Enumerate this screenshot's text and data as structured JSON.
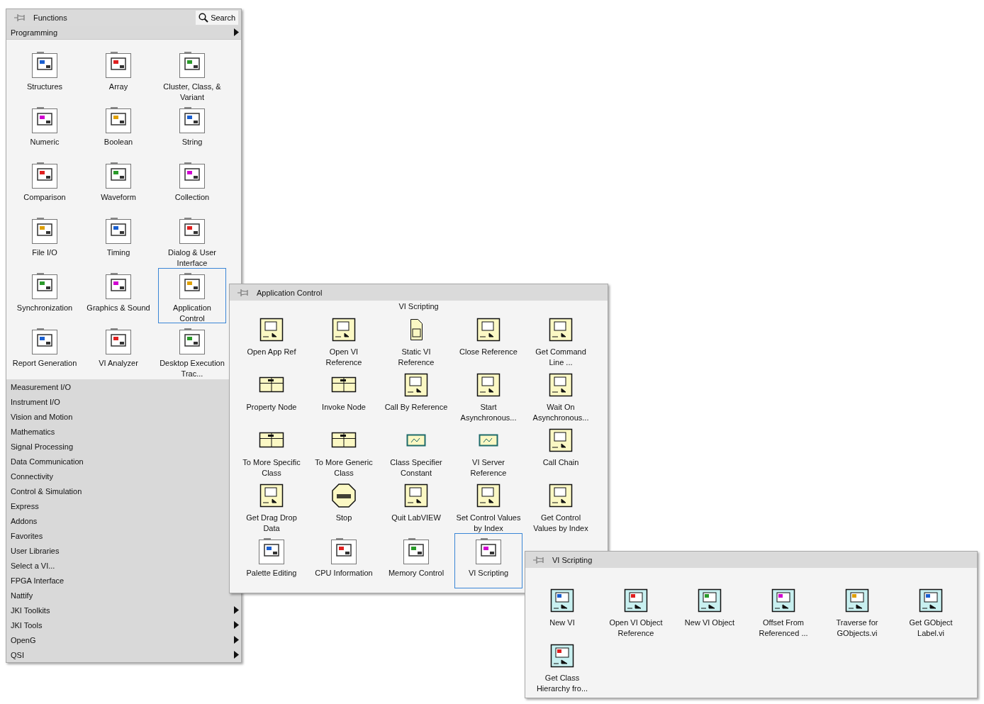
{
  "functions_palette": {
    "title": "Functions",
    "search_button": "Search",
    "categories": [
      {
        "label": "Programming",
        "submenu": true,
        "expanded": true,
        "items": [
          {
            "label": "Structures",
            "kind": "folder",
            "selected": false
          },
          {
            "label": "Array",
            "kind": "folder",
            "selected": false
          },
          {
            "label": "Cluster, Class, & Variant",
            "kind": "folder",
            "selected": false
          },
          {
            "label": "Numeric",
            "kind": "folder",
            "selected": false
          },
          {
            "label": "Boolean",
            "kind": "folder",
            "selected": false
          },
          {
            "label": "String",
            "kind": "folder",
            "selected": false
          },
          {
            "label": "Comparison",
            "kind": "folder",
            "selected": false
          },
          {
            "label": "Waveform",
            "kind": "folder",
            "selected": false
          },
          {
            "label": "Collection",
            "kind": "folder",
            "selected": false
          },
          {
            "label": "File I/O",
            "kind": "folder",
            "selected": false
          },
          {
            "label": "Timing",
            "kind": "folder",
            "selected": false
          },
          {
            "label": "Dialog & User Interface",
            "kind": "folder",
            "selected": false
          },
          {
            "label": "Synchronization",
            "kind": "folder",
            "selected": false
          },
          {
            "label": "Graphics & Sound",
            "kind": "folder",
            "selected": false
          },
          {
            "label": "Application Control",
            "kind": "folder",
            "selected": true
          },
          {
            "label": "Report Generation",
            "kind": "folder",
            "selected": false
          },
          {
            "label": "VI Analyzer",
            "kind": "folder",
            "selected": false
          },
          {
            "label": "Desktop Execution Trac...",
            "kind": "folder",
            "selected": false
          }
        ]
      },
      {
        "label": "Measurement I/O",
        "submenu": false,
        "expanded": false
      },
      {
        "label": "Instrument I/O",
        "submenu": false,
        "expanded": false
      },
      {
        "label": "Vision and Motion",
        "submenu": false,
        "expanded": false
      },
      {
        "label": "Mathematics",
        "submenu": false,
        "expanded": false
      },
      {
        "label": "Signal Processing",
        "submenu": false,
        "expanded": false
      },
      {
        "label": "Data Communication",
        "submenu": false,
        "expanded": false
      },
      {
        "label": "Connectivity",
        "submenu": false,
        "expanded": false
      },
      {
        "label": "Control & Simulation",
        "submenu": false,
        "expanded": false
      },
      {
        "label": "Express",
        "submenu": false,
        "expanded": false
      },
      {
        "label": "Addons",
        "submenu": false,
        "expanded": false
      },
      {
        "label": "Favorites",
        "submenu": false,
        "expanded": false
      },
      {
        "label": "User Libraries",
        "submenu": false,
        "expanded": false
      },
      {
        "label": "Select a VI...",
        "submenu": false,
        "expanded": false
      },
      {
        "label": "FPGA Interface",
        "submenu": false,
        "expanded": false
      },
      {
        "label": "Nattify",
        "submenu": false,
        "expanded": false
      },
      {
        "label": "JKI Toolkits",
        "submenu": true,
        "expanded": false
      },
      {
        "label": "JKI Tools",
        "submenu": true,
        "expanded": false
      },
      {
        "label": "OpenG",
        "submenu": true,
        "expanded": false
      },
      {
        "label": "QSI",
        "submenu": true,
        "expanded": false
      }
    ]
  },
  "application_control_palette": {
    "title": "Application Control",
    "section_label": "VI Scripting",
    "items": [
      {
        "label": "Open App Ref",
        "kind": "function",
        "selected": false
      },
      {
        "label": "Open VI Reference",
        "kind": "function",
        "selected": false
      },
      {
        "label": "Static VI Reference",
        "kind": "document",
        "selected": false
      },
      {
        "label": "Close Reference",
        "kind": "function",
        "selected": false
      },
      {
        "label": "Get Command Line ...",
        "kind": "function",
        "selected": false
      },
      {
        "label": "Property Node",
        "kind": "node",
        "selected": false
      },
      {
        "label": "Invoke Node",
        "kind": "node",
        "selected": false
      },
      {
        "label": "Call By Reference",
        "kind": "function",
        "selected": false
      },
      {
        "label": "Start Asynchronous...",
        "kind": "function",
        "selected": false
      },
      {
        "label": "Wait On Asynchronous...",
        "kind": "function",
        "selected": false
      },
      {
        "label": "To More Specific Class",
        "kind": "node",
        "selected": false
      },
      {
        "label": "To More Generic Class",
        "kind": "node",
        "selected": false
      },
      {
        "label": "Class Specifier Constant",
        "kind": "constant",
        "selected": false
      },
      {
        "label": "VI Server Reference",
        "kind": "constant",
        "selected": false
      },
      {
        "label": "Call Chain",
        "kind": "function",
        "selected": false
      },
      {
        "label": "Get Drag Drop Data",
        "kind": "function",
        "selected": false
      },
      {
        "label": "Stop",
        "kind": "stop",
        "selected": false
      },
      {
        "label": "Quit LabVIEW",
        "kind": "function",
        "selected": false
      },
      {
        "label": "Set Control Values by Index",
        "kind": "function",
        "selected": false
      },
      {
        "label": "Get Control Values by Index",
        "kind": "function",
        "selected": false
      },
      {
        "label": "Palette Editing",
        "kind": "folder",
        "selected": false
      },
      {
        "label": "CPU Information",
        "kind": "folder",
        "selected": false
      },
      {
        "label": "Memory Control",
        "kind": "folder",
        "selected": false
      },
      {
        "label": "VI Scripting",
        "kind": "folder",
        "selected": true
      }
    ]
  },
  "vi_scripting_palette": {
    "title": "VI Scripting",
    "items": [
      {
        "label": "New VI",
        "kind": "vi",
        "selected": false
      },
      {
        "label": "Open VI Object Reference",
        "kind": "vi",
        "selected": false
      },
      {
        "label": "New VI Object",
        "kind": "vi",
        "selected": false
      },
      {
        "label": "Offset From Referenced ...",
        "kind": "vi",
        "selected": false
      },
      {
        "label": "Traverse for GObjects.vi",
        "kind": "vi",
        "selected": false
      },
      {
        "label": "Get GObject Label.vi",
        "kind": "vi",
        "selected": false
      },
      {
        "label": "Get Class Hierarchy fro...",
        "kind": "vi",
        "selected": false
      }
    ]
  }
}
